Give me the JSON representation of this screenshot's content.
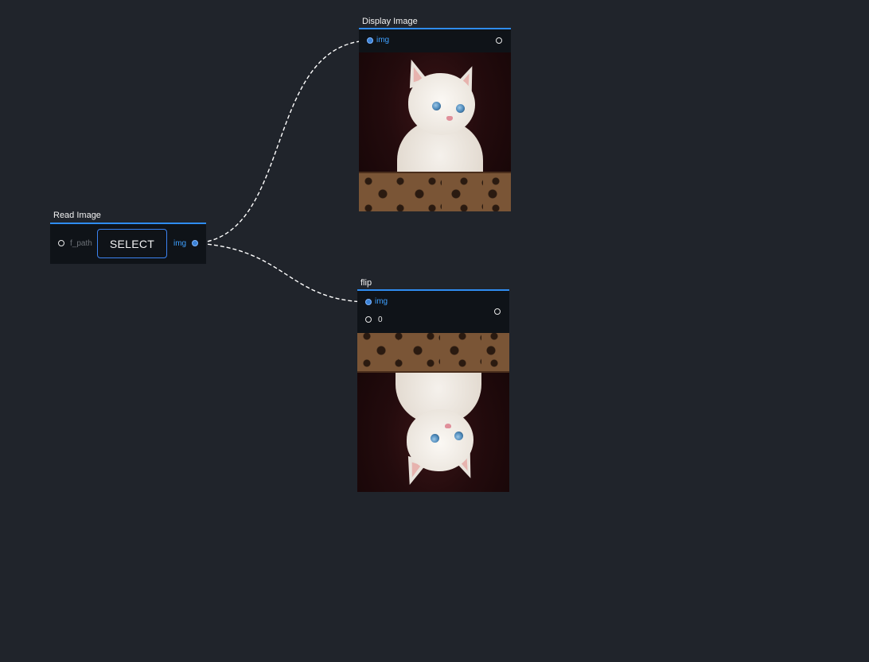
{
  "nodes": {
    "read_image": {
      "title": "Read Image",
      "inputs": [
        {
          "label": "f_path"
        }
      ],
      "button_label": "SELECT",
      "outputs": [
        {
          "label": "img"
        }
      ]
    },
    "display_image": {
      "title": "Display Image",
      "inputs": [
        {
          "label": "img"
        }
      ],
      "image": "kitten-photo"
    },
    "flip": {
      "title": "flip",
      "inputs": [
        {
          "label": "img"
        },
        {
          "label": "0"
        }
      ],
      "image": "kitten-photo-flipped"
    }
  },
  "connections": [
    {
      "from": "read_image.img",
      "to": "display_image.img"
    },
    {
      "from": "read_image.img",
      "to": "flip.img"
    }
  ],
  "colors": {
    "canvas_bg": "#20242b",
    "node_bg": "#0f1318",
    "accent": "#2f8cf0",
    "port_active_label": "#3ea0ff",
    "wire": "#ffffff"
  }
}
